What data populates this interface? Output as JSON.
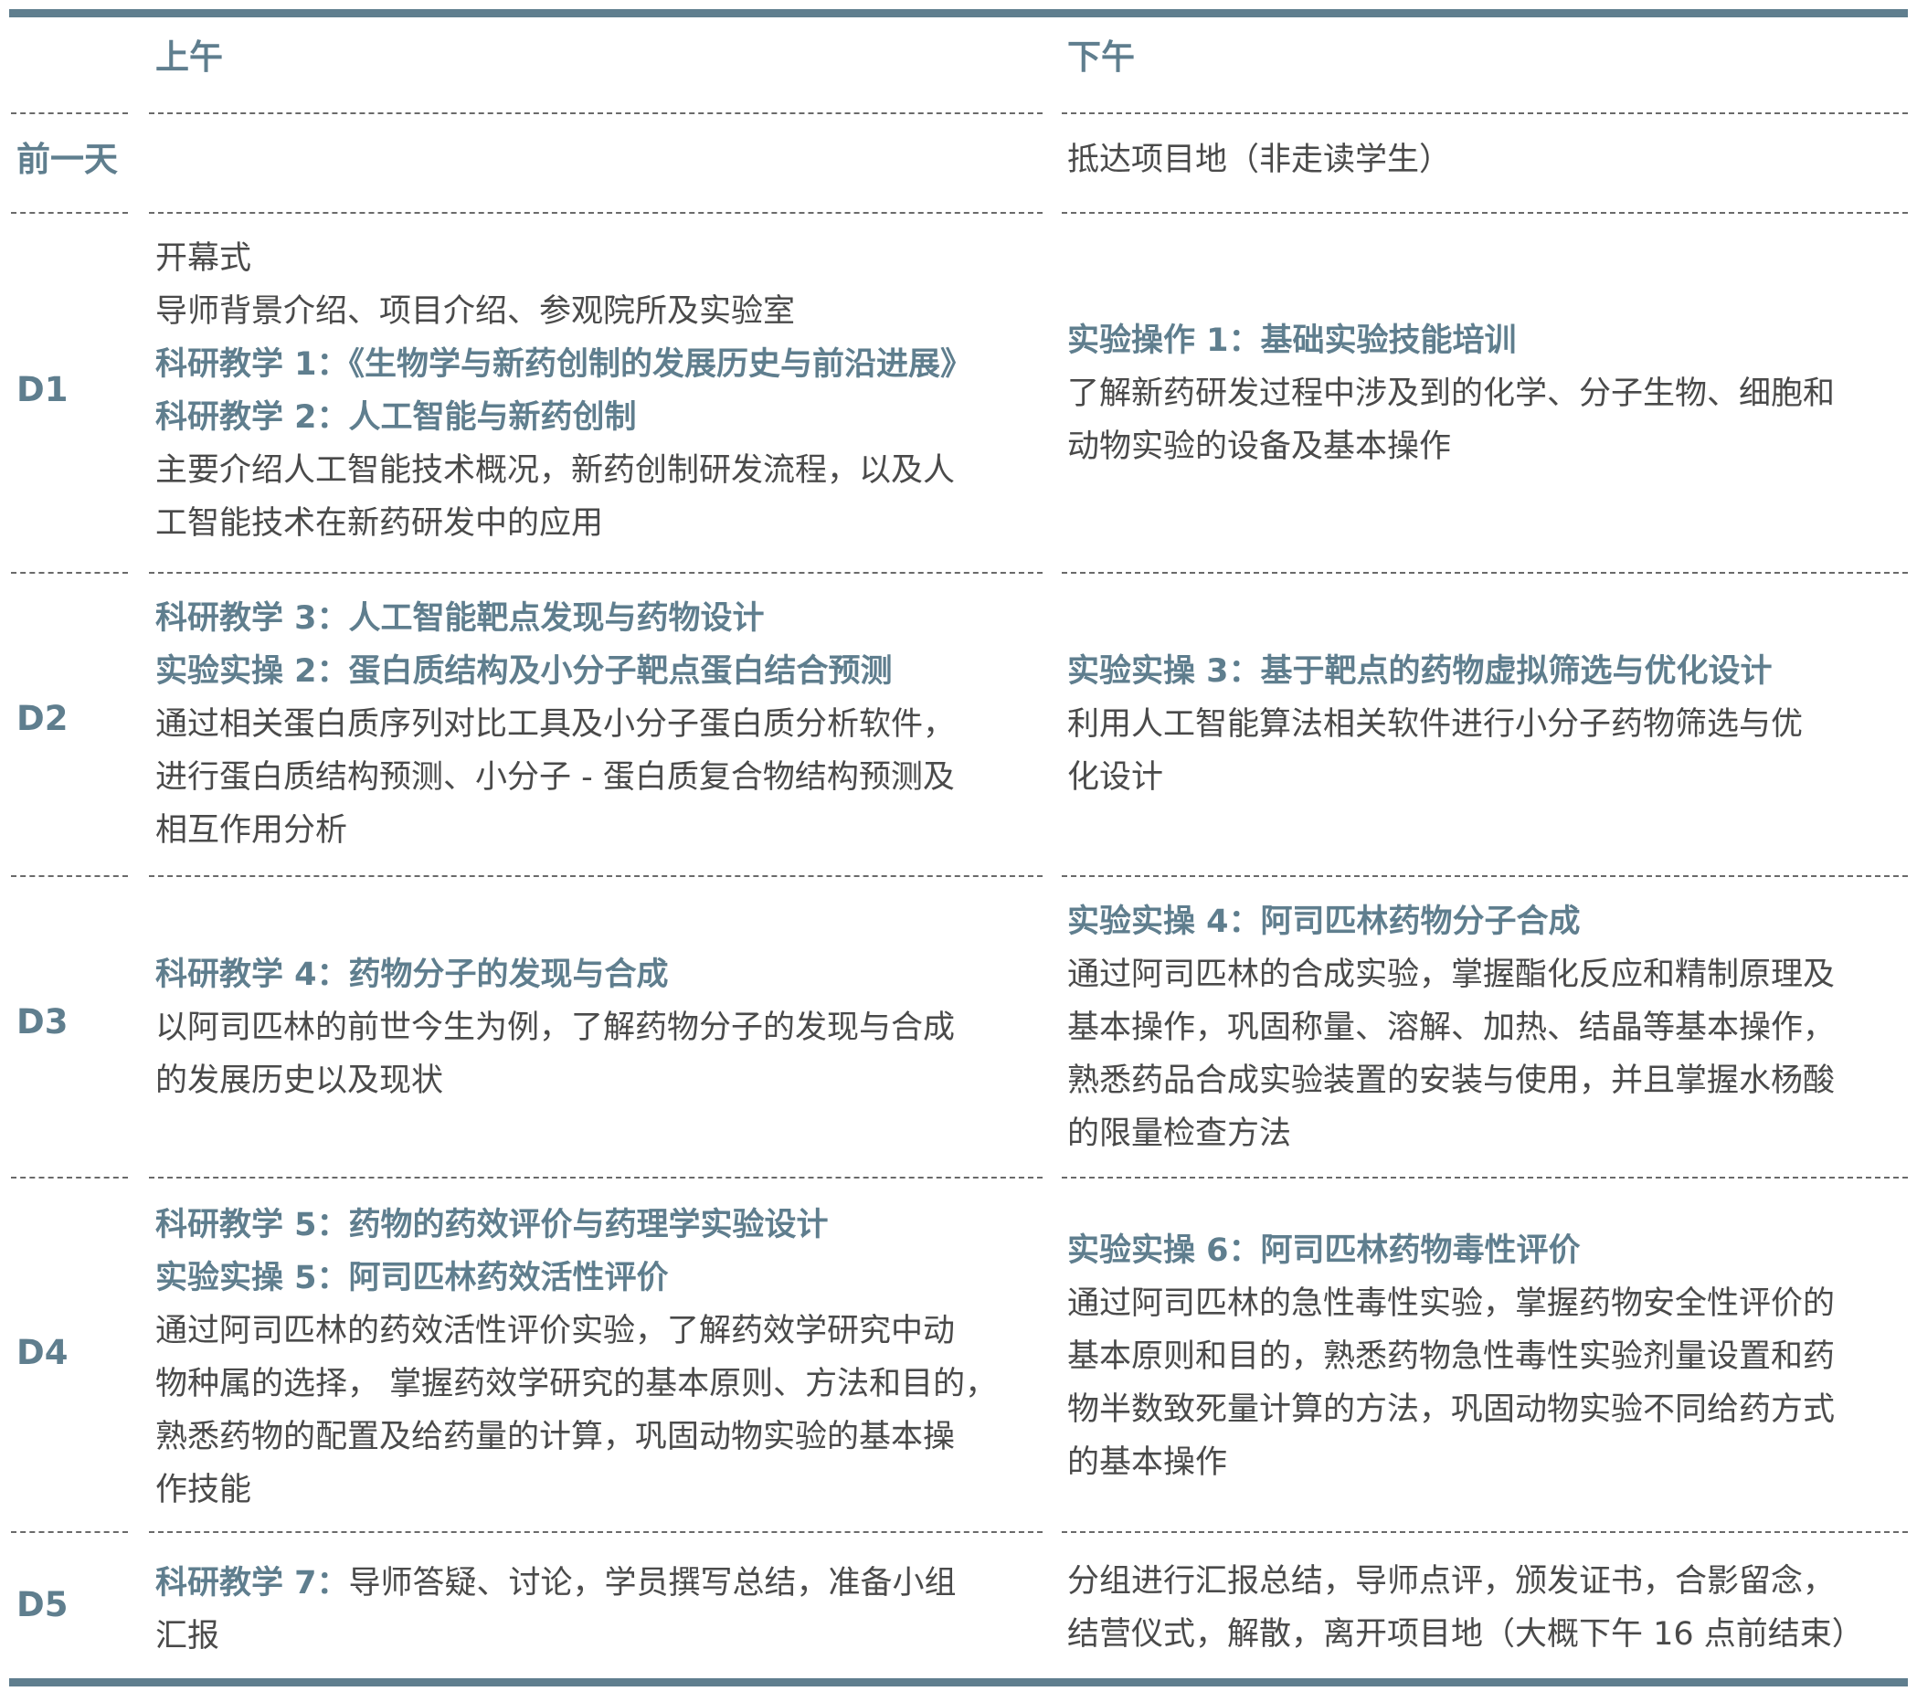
{
  "header": {
    "am": "上午",
    "pm": "下午"
  },
  "rows": [
    {
      "label": "前一天",
      "am": [],
      "pm": [
        {
          "text": "抵达项目地（非走读学生）"
        }
      ]
    },
    {
      "label": "D1",
      "am": [
        {
          "text": "开幕式"
        },
        {
          "text": "导师背景介绍、项目介绍、参观院所及实验室"
        },
        {
          "title": "科研教学 1：《生物学与新药创制的发展历史与前沿进展》"
        },
        {
          "title": "科研教学 2：人工智能与新药创制"
        },
        {
          "text": "主要介绍人工智能技术概况，新药创制研发流程，以及人"
        },
        {
          "text": "工智能技术在新药研发中的应用"
        }
      ],
      "pm": [
        {
          "title": "实验操作 1：基础实验技能培训"
        },
        {
          "text": "了解新药研发过程中涉及到的化学、分子生物、细胞和"
        },
        {
          "text": "动物实验的设备及基本操作"
        }
      ]
    },
    {
      "label": "D2",
      "am": [
        {
          "title": "科研教学 3：人工智能靶点发现与药物设计"
        },
        {
          "title": "实验实操 2：蛋白质结构及小分子靶点蛋白结合预测"
        },
        {
          "text": "通过相关蛋白质序列对比工具及小分子蛋白质分析软件，"
        },
        {
          "text": "进行蛋白质结构预测、小分子 - 蛋白质复合物结构预测及"
        },
        {
          "text": "相互作用分析"
        }
      ],
      "pm": [
        {
          "title": "实验实操 3：基于靶点的药物虚拟筛选与优化设计"
        },
        {
          "text": " 利用人工智能算法相关软件进行小分子药物筛选与优"
        },
        {
          "text": "化设计"
        }
      ]
    },
    {
      "label": "D3",
      "am": [
        {
          "title": "科研教学 4：药物分子的发现与合成"
        },
        {
          "text": " 以阿司匹林的前世今生为例，了解药物分子的发现与合成"
        },
        {
          "text": "的发展历史以及现状"
        }
      ],
      "pm": [
        {
          "title": "实验实操 4：阿司匹林药物分子合成"
        },
        {
          "text": " 通过阿司匹林的合成实验，掌握酯化反应和精制原理及"
        },
        {
          "text": "基本操作，巩固称量、溶解、加热、结晶等基本操作，"
        },
        {
          "text": "熟悉药品合成实验装置的安装与使用，并且掌握水杨酸"
        },
        {
          "text": "的限量检查方法"
        }
      ]
    },
    {
      "label": "D4",
      "am": [
        {
          "title": "科研教学 5：药物的药效评价与药理学实验设计"
        },
        {
          "title": "实验实操 5：阿司匹林药效活性评价"
        },
        {
          "text": "通过阿司匹林的药效活性评价实验，了解药效学研究中动"
        },
        {
          "text": "物种属的选择， 掌握药效学研究的基本原则、方法和目的，"
        },
        {
          "text": "熟悉药物的配置及给药量的计算，巩固动物实验的基本操"
        },
        {
          "text": "作技能"
        }
      ],
      "pm": [
        {
          "title": "实验实操 6：阿司匹林药物毒性评价"
        },
        {
          "text": " 通过阿司匹林的急性毒性实验，掌握药物安全性评价的"
        },
        {
          "text": "基本原则和目的，熟悉药物急性毒性实验剂量设置和药"
        },
        {
          "text": "物半数致死量计算的方法，巩固动物实验不同给药方式"
        },
        {
          "text": "的基本操作"
        }
      ]
    },
    {
      "label": "D5",
      "am": [
        {
          "title": "科研教学 7：",
          "text": "导师答疑、讨论，学员撰写总结，准备小组"
        },
        {
          "text": "汇报"
        }
      ],
      "pm": [
        {
          "text": "分组进行汇报总结，导师点评，颁发证书，合影留念，"
        },
        {
          "text": "结营仪式，解散，离开项目地（大概下午 16 点前结束）"
        }
      ]
    }
  ]
}
